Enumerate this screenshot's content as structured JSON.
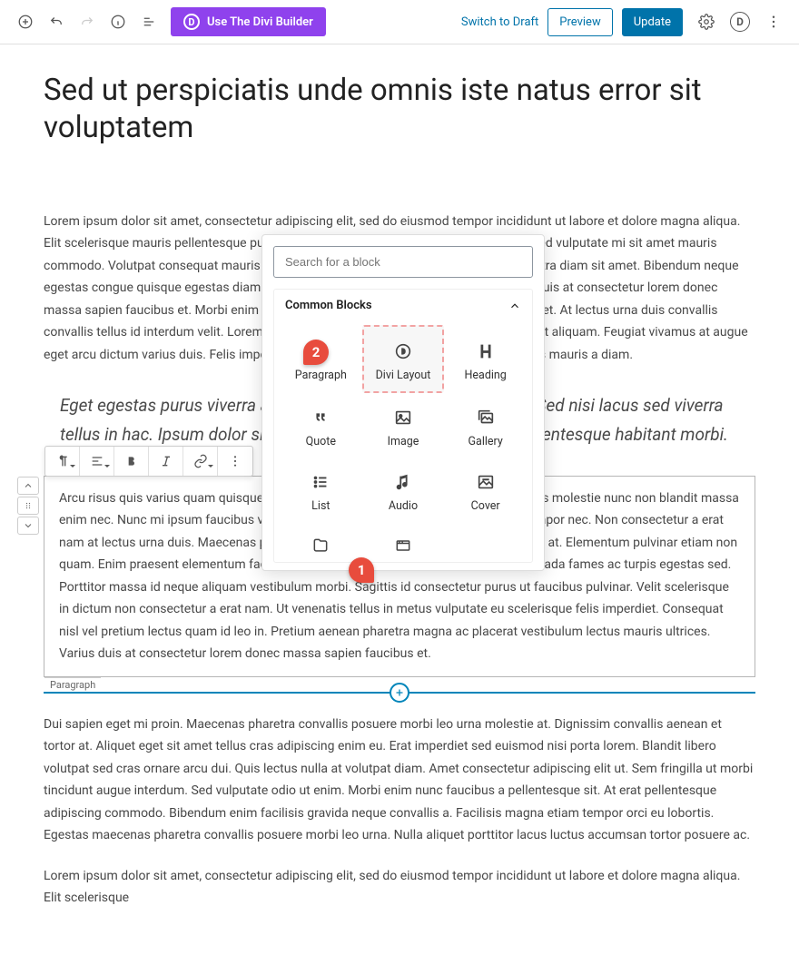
{
  "toolbar": {
    "divi_label": "Use The Divi Builder",
    "switch_draft": "Switch to Draft",
    "preview": "Preview",
    "update": "Update"
  },
  "post": {
    "title": "Sed ut perspiciatis unde omnis iste natus error sit voluptatem",
    "p1": "Lorem ipsum dolor sit amet, consectetur adipiscing elit, sed do eiusmod tempor incididunt ut labore et dolore magna aliqua. Elit scelerisque mauris pellentesque pulvinar pellentesque habitant morbi tristique. Elit sed vulputate mi sit amet mauris commodo. Volutpat consequat mauris nunc congue nisi vitae suscipit tellus. Nulla pharetra diam sit amet. Bibendum neque egestas congue quisque egestas diam in arcu cursus euismod quis viverra nibh. Varius duis at consectetur lorem donec massa sapien faucibus et. Morbi enim nunc faucibus a pellentesque sit amet porttitor eget. At lectus urna duis convallis convallis tellus id interdum velit. Lorem ipsum dolor sit amet consectetur adipiscing elit ut aliquam. Feugiat vivamus at augue eget arcu dictum varius duis. Felis imperdiet proin fermentum leo vel. Vitae suscipit tellus mauris a diam.",
    "quote": "Eget egestas purus viverra accumsan in nisl nisi scelerisque eu. Sed nisi lacus sed viverra tellus in hac. Ipsum dolor sit amet consectetur adipiscing elit pellentesque habitant morbi.",
    "p_block": "Arcu risus quis varius quam quisque. Ut enim ut sem viverra aliquet eget sit. Nibh tellus molestie nunc non blandit massa enim nec. Nunc mi ipsum faucibus vitae aliquet. Aliquam faucibus purus in massa tempor nec. Non consectetur a erat nam at lectus urna duis. Maecenas pharetra convallis posuere morbi leo urna molestie at. Elementum pulvinar etiam non quam. Enim praesent elementum facilisis leo vel fringilla est ullamcorper eget. Malesuada fames ac turpis egestas sed. Porttitor massa id neque aliquam vestibulum morbi. Sagittis id consectetur purus ut faucibus pulvinar. Velit scelerisque in dictum non consectetur a erat nam. Ut venenatis tellus in metus vulputate eu scelerisque felis imperdiet. Consequat nisl vel pretium lectus quam id leo in. Pretium aenean pharetra magna ac placerat vestibulum lectus mauris ultrices. Varius duis at consectetur lorem donec massa sapien faucibus et.",
    "block_tag": "Paragraph",
    "p3": "Dui sapien eget mi proin. Maecenas pharetra convallis posuere morbi leo urna molestie at. Dignissim convallis aenean et tortor at. Aliquet eget sit amet tellus cras adipiscing enim eu. Erat imperdiet sed euismod nisi porta lorem. Blandit libero volutpat sed cras ornare arcu dui. Quis lectus nulla at volutpat diam. Amet consectetur adipiscing elit ut. Sem fringilla ut morbi tincidunt augue interdum. Sed vulputate odio ut enim. Morbi enim nunc faucibus a pellentesque sit. At erat pellentesque adipiscing commodo. Bibendum enim facilisis gravida neque convallis a. Facilisis magna etiam tempor orci eu lobortis. Egestas maecenas pharetra convallis posuere morbi leo urna. Nulla aliquet porttitor lacus luctus accumsan tortor posuere ac.",
    "p4": "Lorem ipsum dolor sit amet, consectetur adipiscing elit, sed do eiusmod tempor incididunt ut labore et dolore magna aliqua. Elit scelerisque"
  },
  "inserter": {
    "search_placeholder": "Search for a block",
    "section_title": "Common Blocks",
    "items": {
      "paragraph": "Paragraph",
      "divi_layout": "Divi Layout",
      "heading": "Heading",
      "quote": "Quote",
      "image": "Image",
      "gallery": "Gallery",
      "list": "List",
      "audio": "Audio",
      "cover": "Cover"
    }
  },
  "callouts": {
    "one": "1",
    "two": "2"
  }
}
